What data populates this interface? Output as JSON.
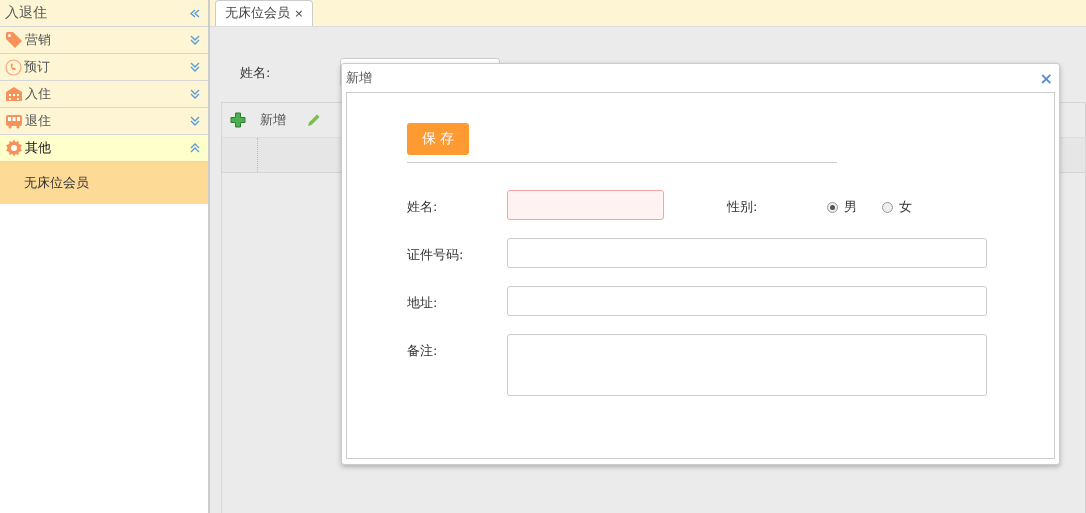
{
  "sidebar": {
    "title": "入退住",
    "sections": [
      {
        "label": "营销",
        "kind": "tag",
        "expanded": false
      },
      {
        "label": "预订",
        "kind": "phone",
        "expanded": false
      },
      {
        "label": "入住",
        "kind": "building",
        "expanded": false
      },
      {
        "label": "退住",
        "kind": "bus",
        "expanded": false
      },
      {
        "label": "其他",
        "kind": "gear",
        "expanded": true,
        "children": [
          {
            "label": "无床位会员",
            "selected": true
          }
        ]
      }
    ]
  },
  "tabs": [
    {
      "label": "无床位会员",
      "selected": true,
      "close": "×"
    }
  ],
  "search": {
    "label": "姓名:"
  },
  "toolbar": [
    {
      "label": "新增",
      "kind": "add"
    },
    {
      "kind": "edit"
    }
  ],
  "dialog": {
    "title": "新增",
    "close": "×",
    "save": "保 存",
    "fields": [
      {
        "label": "姓名:",
        "kind": "input",
        "invalid": true
      },
      {
        "label": "性别:",
        "kind": "radio",
        "options": [
          {
            "label": "男",
            "selected": true
          },
          {
            "label": "女",
            "selected": false
          }
        ]
      },
      {
        "label": "证件号码:",
        "kind": "input",
        "invalid": false
      },
      {
        "label": "地址:",
        "kind": "input",
        "invalid": false
      },
      {
        "label": "备注:",
        "kind": "textarea",
        "invalid": false
      }
    ]
  }
}
